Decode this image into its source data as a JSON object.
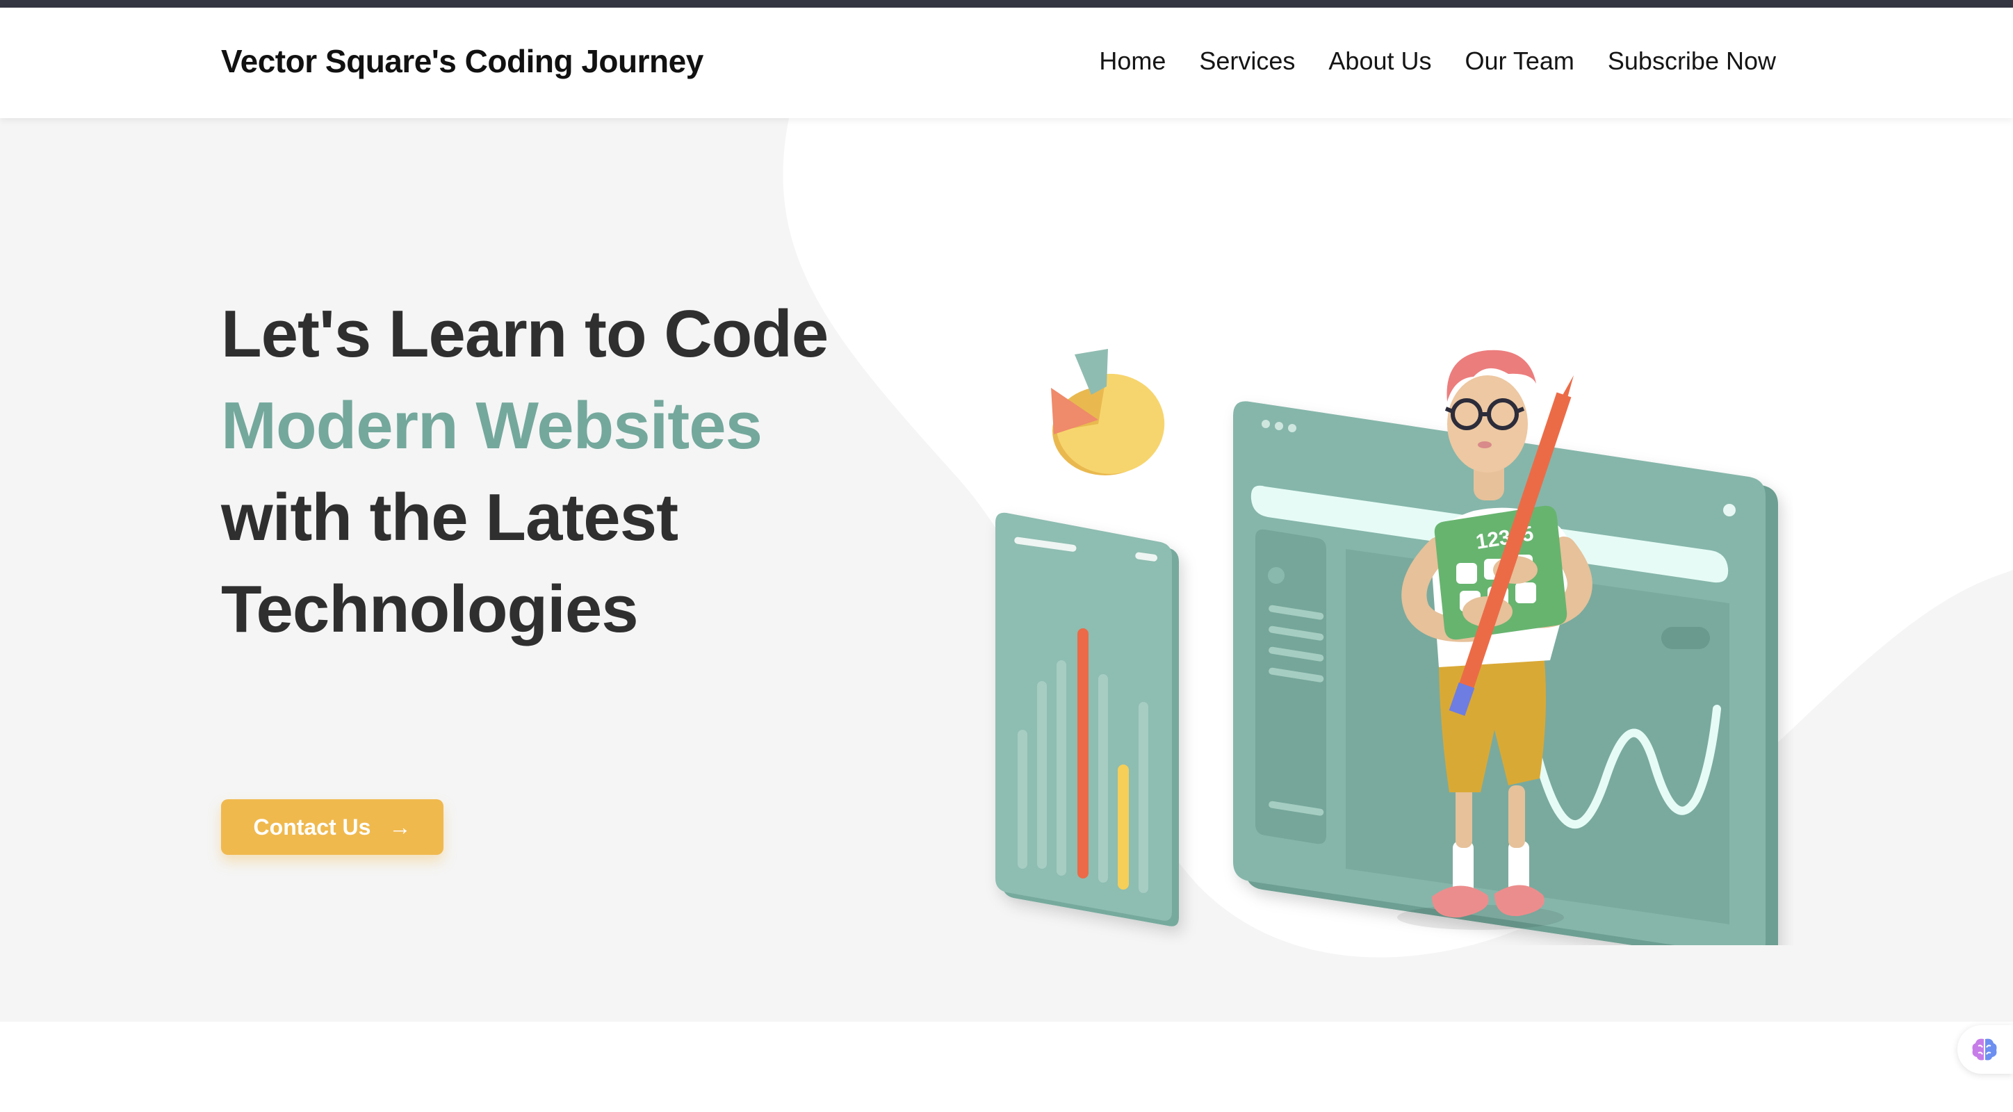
{
  "nav": {
    "brand": "Vector Square's Coding Journey",
    "links": [
      "Home",
      "Services",
      "About Us",
      "Our Team",
      "Subscribe Now"
    ]
  },
  "hero": {
    "headline_part1": "Let's Learn to Code ",
    "headline_accent": "Modern Websites",
    "headline_part2": " with the Latest Technologies",
    "cta_label": "Contact Us",
    "cta_icon": "arrow-right-icon",
    "calculator_text": "12345"
  },
  "colors": {
    "accent": "#74a89c",
    "cta": "#f0b94e",
    "topbar": "#343642",
    "hero_bg": "#f5f5f5"
  },
  "floating_widget": {
    "icon": "brain-icon"
  }
}
